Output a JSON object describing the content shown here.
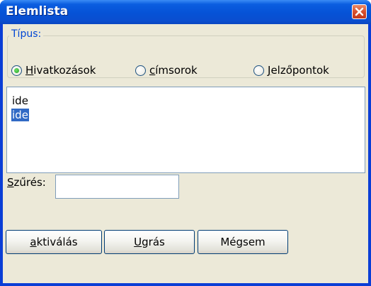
{
  "window": {
    "title": "Elemlista",
    "colors": {
      "titlebar": "#0a5de0",
      "client": "#ece9d8",
      "selection": "#316ac5"
    }
  },
  "type_group": {
    "label": "Típus:",
    "options": [
      {
        "access_key": "H",
        "rest": "ivatkozások",
        "checked": true
      },
      {
        "access_key": "c",
        "rest": "ímsorok",
        "checked": false
      },
      {
        "access_key": "J",
        "rest": "elzőpontok",
        "checked": false
      }
    ]
  },
  "list": {
    "items": [
      {
        "text": "ide",
        "selected": false
      },
      {
        "text": "ide",
        "selected": true
      }
    ]
  },
  "filter": {
    "label_access_key": "S",
    "label_rest": "zűrés:",
    "value": ""
  },
  "buttons": [
    {
      "access_key": "a",
      "rest": "ktiválás"
    },
    {
      "access_key": "U",
      "rest": "grás"
    },
    {
      "access_key": "",
      "rest": "Mégsem"
    }
  ]
}
